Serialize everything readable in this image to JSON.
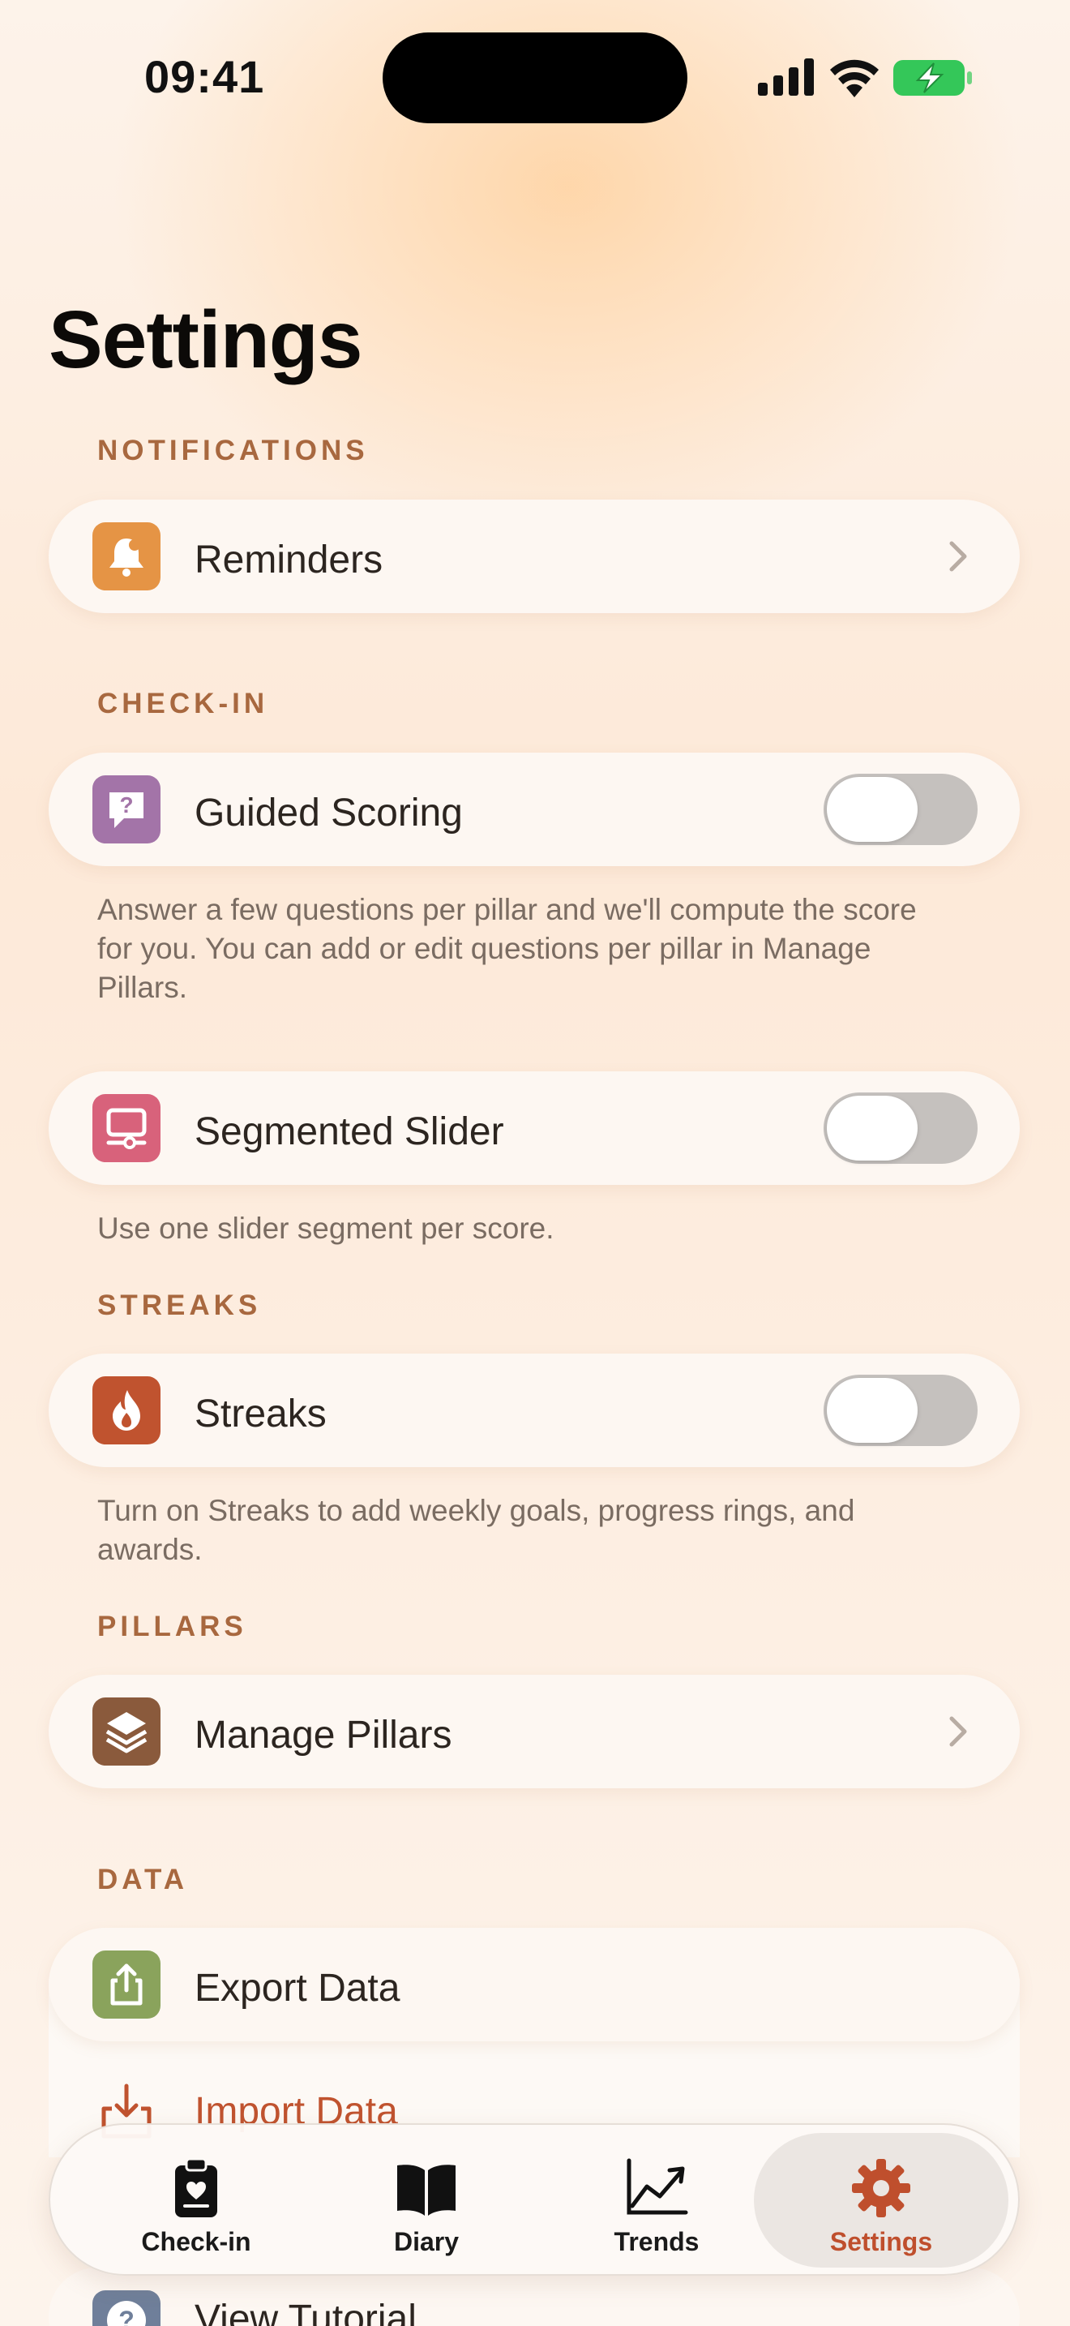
{
  "status_bar": {
    "time": "09:41"
  },
  "page": {
    "title": "Settings"
  },
  "sections": {
    "notifications": {
      "header": "NOTIFICATIONS",
      "reminders": {
        "label": "Reminders",
        "icon": "bell-icon",
        "color": "#e59445"
      }
    },
    "checkin": {
      "header": "CHECK-IN",
      "guided_scoring": {
        "label": "Guided Scoring",
        "icon": "question-bubble-icon",
        "color": "#a374a8",
        "enabled": false,
        "description": "Answer a few questions per pillar and we'll compute the score for you. You can add or edit questions per pillar in Manage Pillars."
      },
      "segmented_slider": {
        "label": "Segmented Slider",
        "icon": "monitor-slider-icon",
        "color": "#d8627b",
        "enabled": false,
        "description": "Use one slider segment per score."
      }
    },
    "streaks": {
      "header": "STREAKS",
      "streaks": {
        "label": "Streaks",
        "icon": "flame-icon",
        "color": "#c0532f",
        "enabled": false,
        "description": "Turn on Streaks to add weekly goals, progress rings, and awards."
      }
    },
    "pillars": {
      "header": "PILLARS",
      "manage": {
        "label": "Manage Pillars",
        "icon": "layers-icon",
        "color": "#8a5a3c"
      }
    },
    "data": {
      "header": "DATA",
      "export": {
        "label": "Export Data",
        "icon": "share-icon",
        "color": "#8aa35c"
      },
      "import": {
        "label": "Import Data",
        "icon": "download-icon",
        "color": "#c0532f"
      },
      "tutorial": {
        "label": "View Tutorial",
        "icon": "help-icon",
        "color": "#6f7f9a"
      }
    }
  },
  "tabbar": {
    "tabs": [
      {
        "label": "Check-in",
        "icon": "clipboard-heart-icon"
      },
      {
        "label": "Diary",
        "icon": "book-icon"
      },
      {
        "label": "Trends",
        "icon": "chart-line-icon"
      },
      {
        "label": "Settings",
        "icon": "gear-icon",
        "active": true
      }
    ],
    "active_color": "#bf4f2d"
  }
}
